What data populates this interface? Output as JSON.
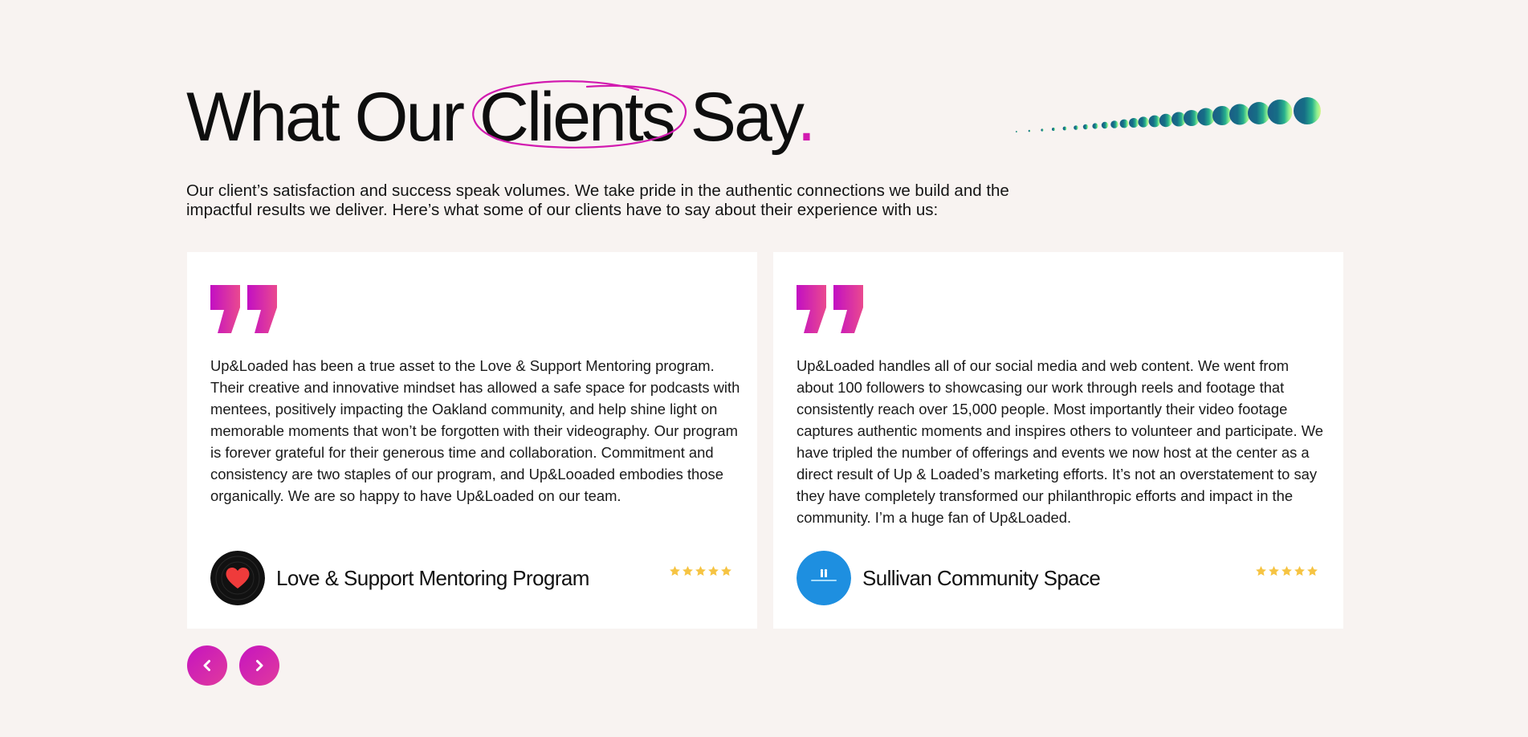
{
  "header": {
    "title_part1": "What Our ",
    "title_highlight": "Clients",
    "title_part2": " Say",
    "title_dot": ".",
    "intro": "Our client’s satisfaction and success speak volumes. We take pride in the authentic connections we build and the impactful results we deliver. Here’s what some of our clients have to say about their experience with us:"
  },
  "colors": {
    "accent_magenta": "#d21bb0",
    "gradient_start": "#c514c0",
    "gradient_end": "#e13a9d",
    "background": "#f8f3f1",
    "card": "#ffffff",
    "star": "#f6c443"
  },
  "testimonials": [
    {
      "quote": "Up&Loaded has been a true asset to the Love & Support Mentoring program. Their creative and innovative mindset has allowed a safe space for podcasts with mentees, positively impacting the Oakland community, and help shine light on memorable moments that won’t be forgotten with their videography. Our program is forever grateful for their generous time and collaboration. Commitment and consistency are two staples of our program, and Up&Looaded embodies those organically. We are so happy to have Up&Loaded on our team.",
      "name": "Love & Support Mentoring Program",
      "avatar_icon": "heart-logo-icon",
      "rating": 5
    },
    {
      "quote": "Up&Loaded handles all of our social media and web content. We went from about 100 followers to showcasing our work through reels and footage that consistently reach over 15,000 people. Most importantly their video footage captures authentic moments and inspires others to volunteer and participate. We have tripled the number of offerings and events we now host at the center as a direct result of Up & Loaded’s marketing efforts. It’s not an overstatement to say they have completely transformed our philanthropic efforts and impact in the community. I’m a huge fan of Up&Loaded.",
      "name": "Sullivan Community Space",
      "avatar_icon": "community-logo-icon",
      "rating": 5
    }
  ],
  "navigation": {
    "prev_icon": "chevron-left-icon",
    "next_icon": "chevron-right-icon"
  }
}
